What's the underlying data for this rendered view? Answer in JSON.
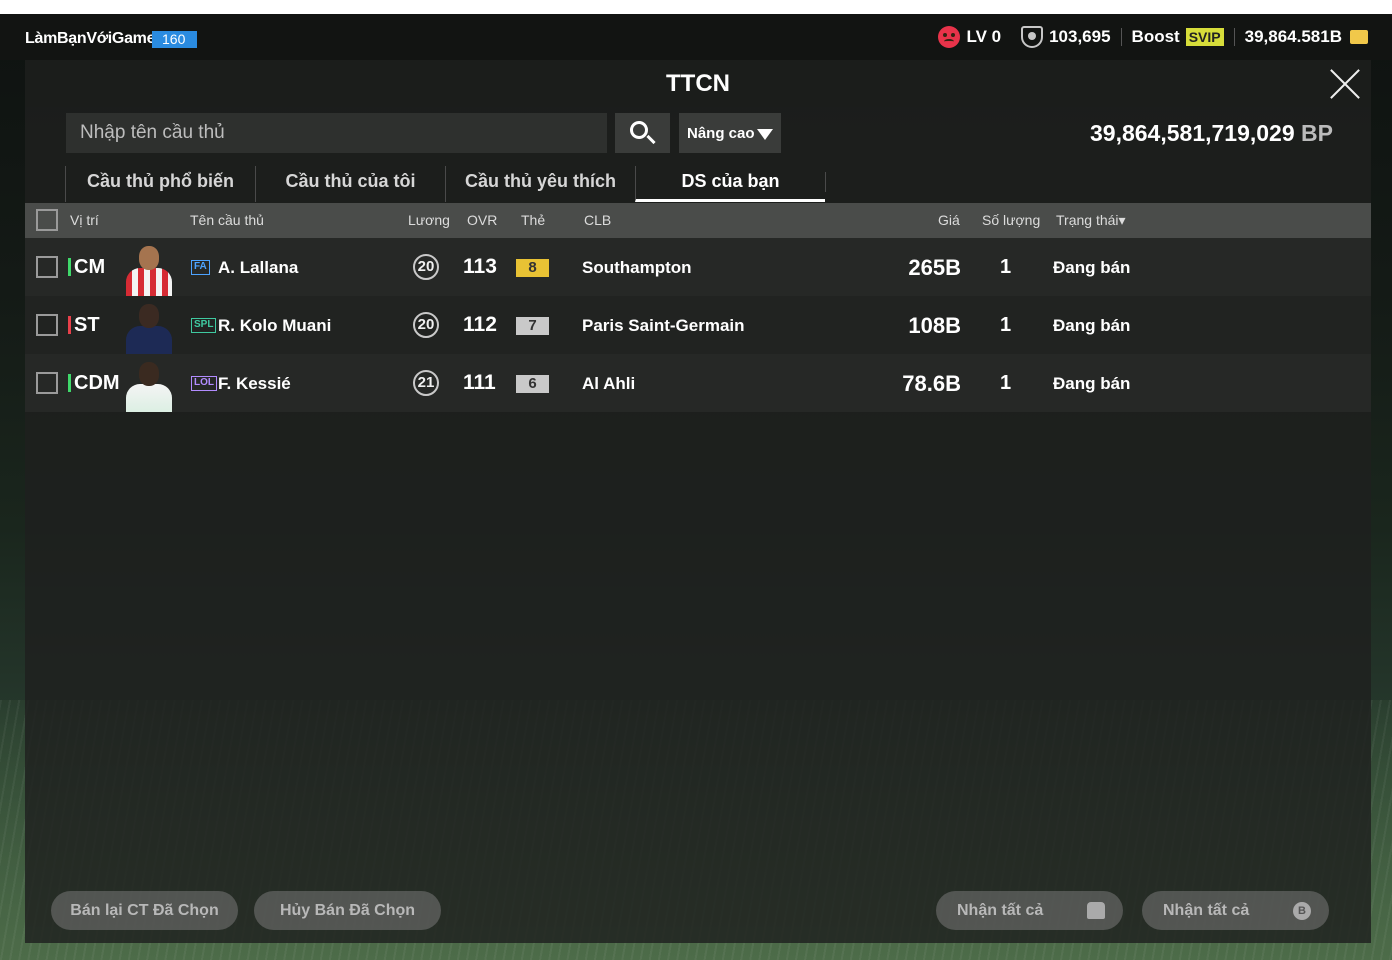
{
  "topbar": {
    "username": "LàmBạnVớiGame",
    "user_level": "160",
    "lv_label": "LV 0",
    "honor_points": "103,695",
    "boost_label": "Boost",
    "svip_label": "SVIP",
    "coins": "39,864.581B"
  },
  "panel": {
    "title": "TTCN",
    "search_placeholder": "Nhập tên cầu thủ",
    "advanced_label": "Nâng cao",
    "balance_value": "39,864,581,719,029",
    "balance_unit": "BP",
    "tabs": [
      {
        "label": "Cầu thủ phổ biến"
      },
      {
        "label": "Cầu thủ của tôi"
      },
      {
        "label": "Cầu thủ yêu thích"
      },
      {
        "label": "DS của bạn",
        "active": true
      }
    ],
    "columns": {
      "position": "Vị trí",
      "player_name": "Tên cầu thủ",
      "salary": "Lương",
      "ovr": "OVR",
      "card": "Thẻ",
      "club": "CLB",
      "price": "Giá",
      "quantity": "Số lượng",
      "status": "Trạng thái▾"
    },
    "rows": [
      {
        "position": "CM",
        "position_color": "#3fd86a",
        "league": "FA",
        "league_color": "#4da3ff",
        "name": "A. Lallana",
        "salary": "20",
        "ovr": "113",
        "card": "8",
        "card_color": "#e8c234",
        "club": "Southampton",
        "price": "265B",
        "quantity": "1",
        "status": "Đang bán"
      },
      {
        "position": "ST",
        "position_color": "#e8404a",
        "league": "SPL",
        "league_color": "#3fc9a0",
        "name": "R. Kolo Muani",
        "salary": "20",
        "ovr": "112",
        "card": "7",
        "card_color": "#c9c9c9",
        "club": "Paris Saint-Germain",
        "price": "108B",
        "quantity": "1",
        "status": "Đang bán"
      },
      {
        "position": "CDM",
        "position_color": "#3fd86a",
        "league": "LOL",
        "league_color": "#b28cff",
        "name": "F. Kessié",
        "salary": "21",
        "ovr": "111",
        "card": "6",
        "card_color": "#c9c9c9",
        "club": "Al Ahli",
        "price": "78.6B",
        "quantity": "1",
        "status": "Đang bán"
      }
    ],
    "buttons": {
      "resell_selected": "Bán lại CT Đã Chọn",
      "cancel_selected": "Hủy Bán Đã Chọn",
      "receive_all_players": "Nhận tất cả",
      "receive_all_bp": "Nhận tất cả"
    }
  }
}
